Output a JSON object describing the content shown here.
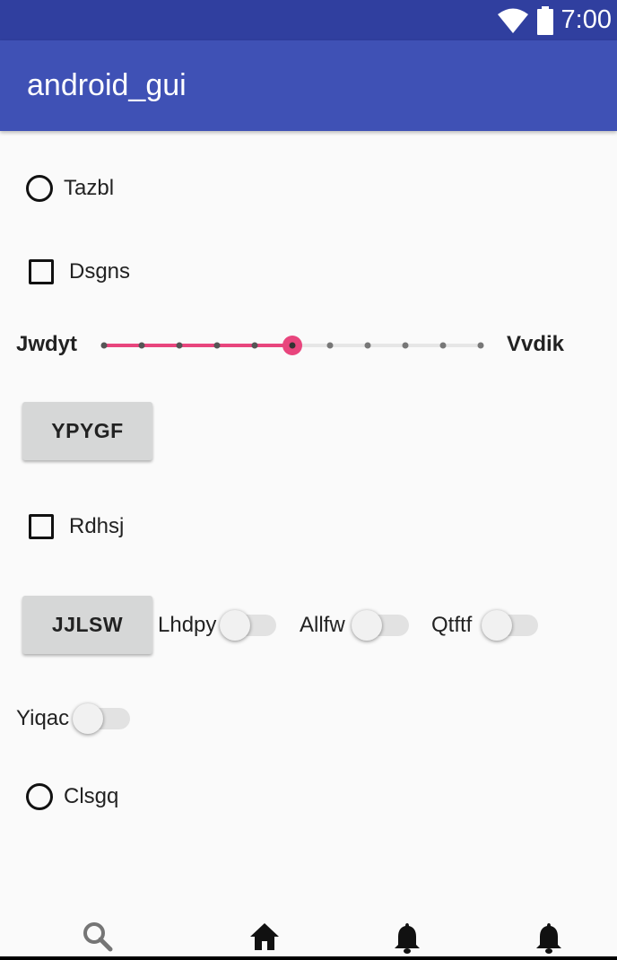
{
  "status_bar": {
    "time": "7:00"
  },
  "app_bar": {
    "title": "android_gui"
  },
  "controls": {
    "radio_1": {
      "label": "Tazbl",
      "checked": false
    },
    "checkbox_1": {
      "label": "Dsgns",
      "checked": false
    },
    "slider": {
      "left_label": "Jwdyt",
      "right_label": "Vvdik",
      "steps": 10,
      "value": 5
    },
    "button_1": {
      "label": "YPYGF"
    },
    "checkbox_2": {
      "label": "Rdhsj",
      "checked": false
    },
    "button_2": {
      "label": "JJLSW"
    },
    "switch_1": {
      "label": "Lhdpy",
      "on": false
    },
    "switch_2": {
      "label": "Allfw",
      "on": false
    },
    "switch_3": {
      "label": "Qtftf",
      "on": false
    },
    "switch_4": {
      "label": "Yiqac",
      "on": false
    },
    "radio_2": {
      "label": "Clsgq",
      "checked": false
    }
  },
  "bottom_nav": {
    "items": [
      {
        "icon": "search-icon"
      },
      {
        "icon": "home-icon"
      },
      {
        "icon": "bell-icon"
      },
      {
        "icon": "bell-icon"
      }
    ]
  },
  "colors": {
    "status_bar": "#303f9f",
    "app_bar": "#3f51b5",
    "accent": "#e8457d"
  }
}
